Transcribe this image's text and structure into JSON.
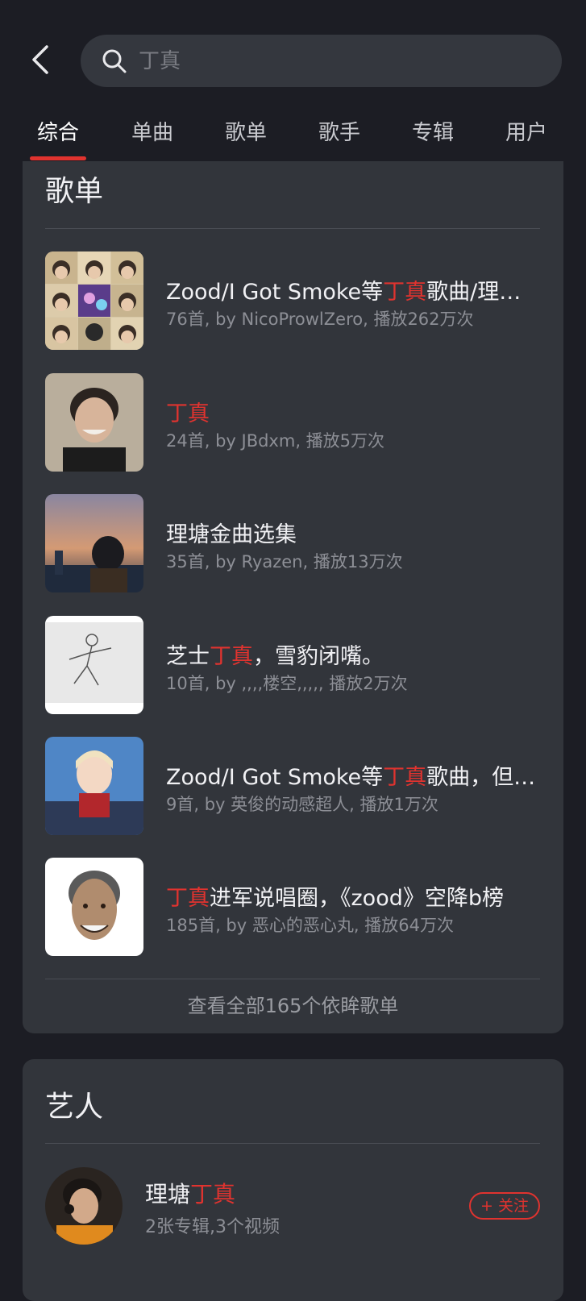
{
  "search": {
    "placeholder": "丁真"
  },
  "tabs": [
    {
      "label": "综合"
    },
    {
      "label": "单曲"
    },
    {
      "label": "歌单"
    },
    {
      "label": "歌手"
    },
    {
      "label": "专辑"
    },
    {
      "label": "用户"
    }
  ],
  "active_tab": "综合",
  "highlight_term": "丁真",
  "playlists_section": {
    "title": "歌单",
    "items": [
      {
        "title_before": "Zood/I Got Smoke等",
        "title_hl": "丁真",
        "title_after": "歌曲/理塘…",
        "meta": "76首, by NicoProwlZero, 播放262万次"
      },
      {
        "title_before": "",
        "title_hl": "丁真",
        "title_after": "",
        "meta": "24首, by JBdxm, 播放5万次"
      },
      {
        "title_before": "理塘金曲选集",
        "title_hl": "",
        "title_after": "",
        "meta": "35首, by Ryazen, 播放13万次"
      },
      {
        "title_before": "芝士",
        "title_hl": "丁真",
        "title_after": "，雪豹闭嘴。",
        "meta": "10首, by ,,,,楼空,,,,, 播放2万次"
      },
      {
        "title_before": "Zood/I Got Smoke等",
        "title_hl": "丁真",
        "title_after": "歌曲，但…",
        "meta": "9首, by 英俊的动感超人, 播放1万次"
      },
      {
        "title_before": "",
        "title_hl": "丁真",
        "title_after": "进军说唱圈，《zood》空降b榜",
        "meta": "185首, by 恶心的恶心丸, 播放64万次"
      }
    ],
    "view_all": "查看全部165个依眸歌单"
  },
  "artists_section": {
    "title": "艺人",
    "artist": {
      "name_before": "理塘",
      "name_hl": "丁真",
      "meta": "2张专辑,3个视频",
      "follow_label": "+ 关注"
    }
  },
  "colors": {
    "background": "#1c1d24",
    "card": "#32353b",
    "accent": "#e0332f",
    "text_primary": "#f1f1f4",
    "text_secondary": "#8d8f96"
  },
  "icons": {
    "back": "chevron-left-icon",
    "search": "search-icon"
  }
}
